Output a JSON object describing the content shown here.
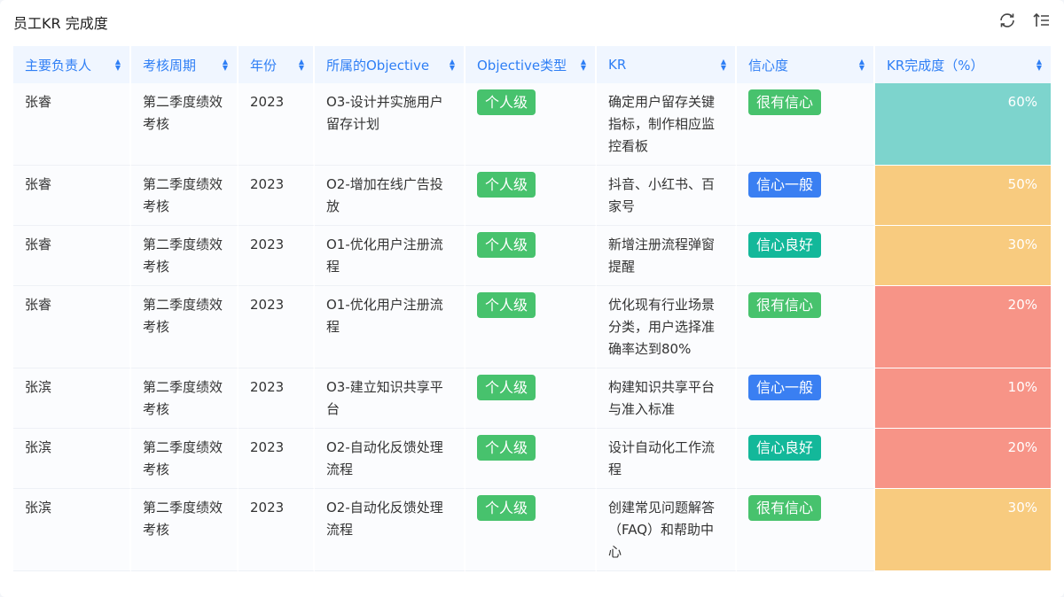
{
  "title": "员工KR 完成度",
  "toolbar": {
    "refresh_icon": "refresh-icon",
    "sort_icon": "sort-list-icon"
  },
  "columns": [
    "主要负责人",
    "考核周期",
    "年份",
    "所属的Objective",
    "Objective类型",
    "KR",
    "信心度",
    "KR完成度（%）"
  ],
  "colors": {
    "green": "#47c26d",
    "blue": "#3a7ff2",
    "teal": "#13b89a",
    "pct_high": "#7dd4cd",
    "pct_mid": "#f8cb7f",
    "pct_low": "#f79487"
  },
  "rows": [
    {
      "owner": "张睿",
      "period": "第二季度绩效考核",
      "year": "2023",
      "objective": "O3-设计并实施用户留存计划",
      "type": "个人级",
      "kr": "确定用户留存关键指标，制作相应监控看板",
      "confidence": "很有信心",
      "conf_color": "green",
      "pct": "60%",
      "pct_color": "pct_high"
    },
    {
      "owner": "张睿",
      "period": "第二季度绩效考核",
      "year": "2023",
      "objective": "O2-增加在线广告投放",
      "type": "个人级",
      "kr": "抖音、小红书、百家号",
      "confidence": "信心一般",
      "conf_color": "blue",
      "pct": "50%",
      "pct_color": "pct_mid"
    },
    {
      "owner": "张睿",
      "period": "第二季度绩效考核",
      "year": "2023",
      "objective": "O1-优化用户注册流程",
      "type": "个人级",
      "kr": "新增注册流程弹窗提醒",
      "confidence": "信心良好",
      "conf_color": "teal",
      "pct": "30%",
      "pct_color": "pct_mid"
    },
    {
      "owner": "张睿",
      "period": "第二季度绩效考核",
      "year": "2023",
      "objective": "O1-优化用户注册流程",
      "type": "个人级",
      "kr": "优化现有行业场景分类，用户选择准确率达到80%",
      "confidence": "很有信心",
      "conf_color": "green",
      "pct": "20%",
      "pct_color": "pct_low"
    },
    {
      "owner": "张滨",
      "period": "第二季度绩效考核",
      "year": "2023",
      "objective": "O3-建立知识共享平台",
      "type": "个人级",
      "kr": "构建知识共享平台与准入标准",
      "confidence": "信心一般",
      "conf_color": "blue",
      "pct": "10%",
      "pct_color": "pct_low"
    },
    {
      "owner": "张滨",
      "period": "第二季度绩效考核",
      "year": "2023",
      "objective": "O2-自动化反馈处理流程",
      "type": "个人级",
      "kr": "设计自动化工作流程",
      "confidence": "信心良好",
      "conf_color": "teal",
      "pct": "20%",
      "pct_color": "pct_low"
    },
    {
      "owner": "张滨",
      "period": "第二季度绩效考核",
      "year": "2023",
      "objective": "O2-自动化反馈处理流程",
      "type": "个人级",
      "kr": "创建常见问题解答（FAQ）和帮助中心",
      "confidence": "很有信心",
      "conf_color": "green",
      "pct": "30%",
      "pct_color": "pct_mid"
    }
  ]
}
